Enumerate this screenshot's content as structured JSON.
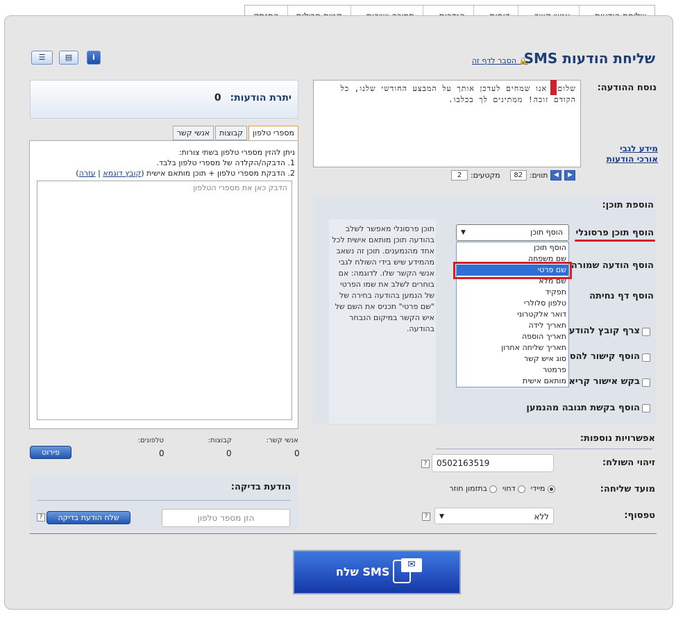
{
  "nav": {
    "items": [
      {
        "label": "שליחת הודעות",
        "caret": "▾"
      },
      {
        "label": "אנשי קשר",
        "caret": "▾"
      },
      {
        "label": "דוחות",
        "caret": "▾"
      },
      {
        "label": "הגדרות",
        "caret": "▾"
      },
      {
        "label": "תמיכה ושירות",
        "caret": "▾"
      },
      {
        "label": "קניית חבילות",
        "caret": ""
      },
      {
        "label": "התנתק",
        "caret": ""
      }
    ]
  },
  "page": {
    "title": "שליחת הודעות SMS",
    "help_link": "הסבר לדף זה"
  },
  "message": {
    "label": "נוסח ההודעה:",
    "text": "שלום, אנו שמחים לעדכן אותך על המבצע החודשי שלנו, כל הקודם זוכה! ממתינים לך בכלבו.",
    "side_link_1": "מידע לגבי",
    "side_link_2": "אורכי הודעות",
    "chars_label": "תווים:",
    "chars_value": "82",
    "segments_label": "מקטעים:",
    "segments_value": "2"
  },
  "add_content": {
    "title": "הוספת תוכן:",
    "personal_label": "הוסף תוכן פרסונלי",
    "saved_label": "הוסף הודעה שמורה",
    "landing_label": "הוסף דף נחיתה",
    "attach_label": "צרף קובץ להודעה",
    "link_label": "הוסף קישור להסרה",
    "confirm_label": "בקש אישור קריאה",
    "response_label": "הוסף בקשת תגובה מהנמען",
    "description": "תוכן פרסונלי מאפשר לשלב בהודעה תוכן מותאם אישית לכל אחד מהנמענים. תוכן זה נשאב מהמידע שיש בידי השולח לגבי אנשי הקשר שלו. לדוגמה: אם בוחרים לשלב את שמו הפרטי של הנמען בהודעה בחירה של \"שם פרטי\" תכניס את השם של איש הקשר במיקום הנבחר בהודעה.",
    "select_value": "הוסף תוכן",
    "options": [
      "הוסף תוכן",
      "שם משפחה",
      "שם פרטי",
      "שם מלא",
      "תפקיד",
      "טלפון סלולרי",
      "דואר אלקטרוני",
      "תאריך לידה",
      "תאריך הוספה",
      "תאריך שליחה אחרון",
      "סוג איש קשר",
      "פרמטר",
      "מותאם אישית"
    ],
    "selected_index": 2
  },
  "extra": {
    "title": "אפשרויות נוספות:",
    "sender_label": "זיהוי השולח:",
    "sender_value": "0502163519",
    "timing_label": "מועד שליחה:",
    "timing_now": "מיידי",
    "timing_later": "דחוי",
    "timing_recurring": "בתזמון חוזר",
    "form_label": "טפסוף:",
    "form_value": "ללא"
  },
  "left": {
    "remaining_label": "יתרת הודעות:",
    "remaining_value": "0",
    "tabs": [
      "מספרי טלפון",
      "קבוצות",
      "אנשי קשר"
    ],
    "intro": "ניתן להזין מספרי טלפון בשתי צורות:",
    "line1": "1. הדבקה/הקלדה של מספרי טלפון בלבד.",
    "line2": "2. הדבקת מספרי טלפון + תוכן מותאם אישית (",
    "sample_file": "קובץ דוגמא",
    "separator": "|",
    "help": "עזרה",
    "close_paren": ")",
    "placeholder": "הדבק כאן את מספרי הטלפון",
    "stats_labels": [
      "אנשי קשר:",
      "קבוצות:",
      "טלפונים:"
    ],
    "stats_values": [
      "0",
      "0",
      "0"
    ],
    "details_button": "פירוט"
  },
  "test": {
    "title": "הודעת בדיקה:",
    "placeholder": "הזן מספר טלפון",
    "button": "שלח הודעת בדיקה"
  },
  "send": {
    "label": "שלח SMS"
  }
}
